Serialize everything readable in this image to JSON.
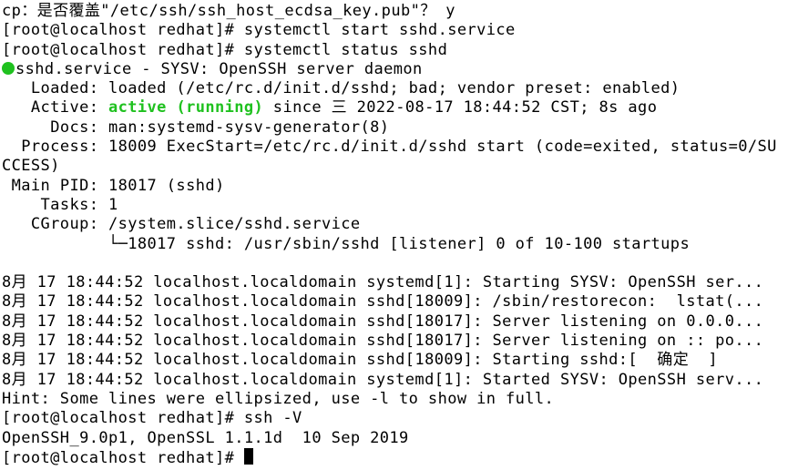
{
  "lines": {
    "l0": "cp：是否覆盖\"/etc/ssh/ssh_host_ecdsa_key.pub\"？ y",
    "l1": "[root@localhost redhat]# systemctl start sshd.service",
    "l2": "[root@localhost redhat]# systemctl status sshd",
    "l3a": "sshd.service - SYSV: OpenSSH server daemon",
    "l4": "   Loaded: loaded (/etc/rc.d/init.d/sshd; bad; vendor preset: enabled)",
    "l5a": "   Active: ",
    "l5b": "active (running)",
    "l5c": " since 三 2022-08-17 18:44:52 CST; 8s ago",
    "l6": "     Docs: man:systemd-sysv-generator(8)",
    "l7": "  Process: 18009 ExecStart=/etc/rc.d/init.d/sshd start (code=exited, status=0/SUCCESS)",
    "l8": " Main PID: 18017 (sshd)",
    "l9": "    Tasks: 1",
    "l10": "   CGroup: /system.slice/sshd.service",
    "l11": "           └─18017 sshd: /usr/sbin/sshd [listener] 0 of 10-100 startups",
    "l12": "",
    "l13": "8月 17 18:44:52 localhost.localdomain systemd[1]: Starting SYSV: OpenSSH ser...",
    "l14": "8月 17 18:44:52 localhost.localdomain sshd[18009]: /sbin/restorecon:  lstat(...",
    "l15": "8月 17 18:44:52 localhost.localdomain sshd[18017]: Server listening on 0.0.0...",
    "l16": "8月 17 18:44:52 localhost.localdomain sshd[18017]: Server listening on :: po...",
    "l17": "8月 17 18:44:52 localhost.localdomain sshd[18009]: Starting sshd:[  确定  ]",
    "l18": "8月 17 18:44:52 localhost.localdomain systemd[1]: Started SYSV: OpenSSH serv...",
    "l19": "Hint: Some lines were ellipsized, use -l to show in full.",
    "l20": "[root@localhost redhat]# ssh -V",
    "l21": "OpenSSH_9.0p1, OpenSSL 1.1.1d  10 Sep 2019",
    "l22": "[root@localhost redhat]# "
  },
  "colors": {
    "active_green": "#1fc11f",
    "fg": "#000000",
    "bg": "#ffffff"
  }
}
